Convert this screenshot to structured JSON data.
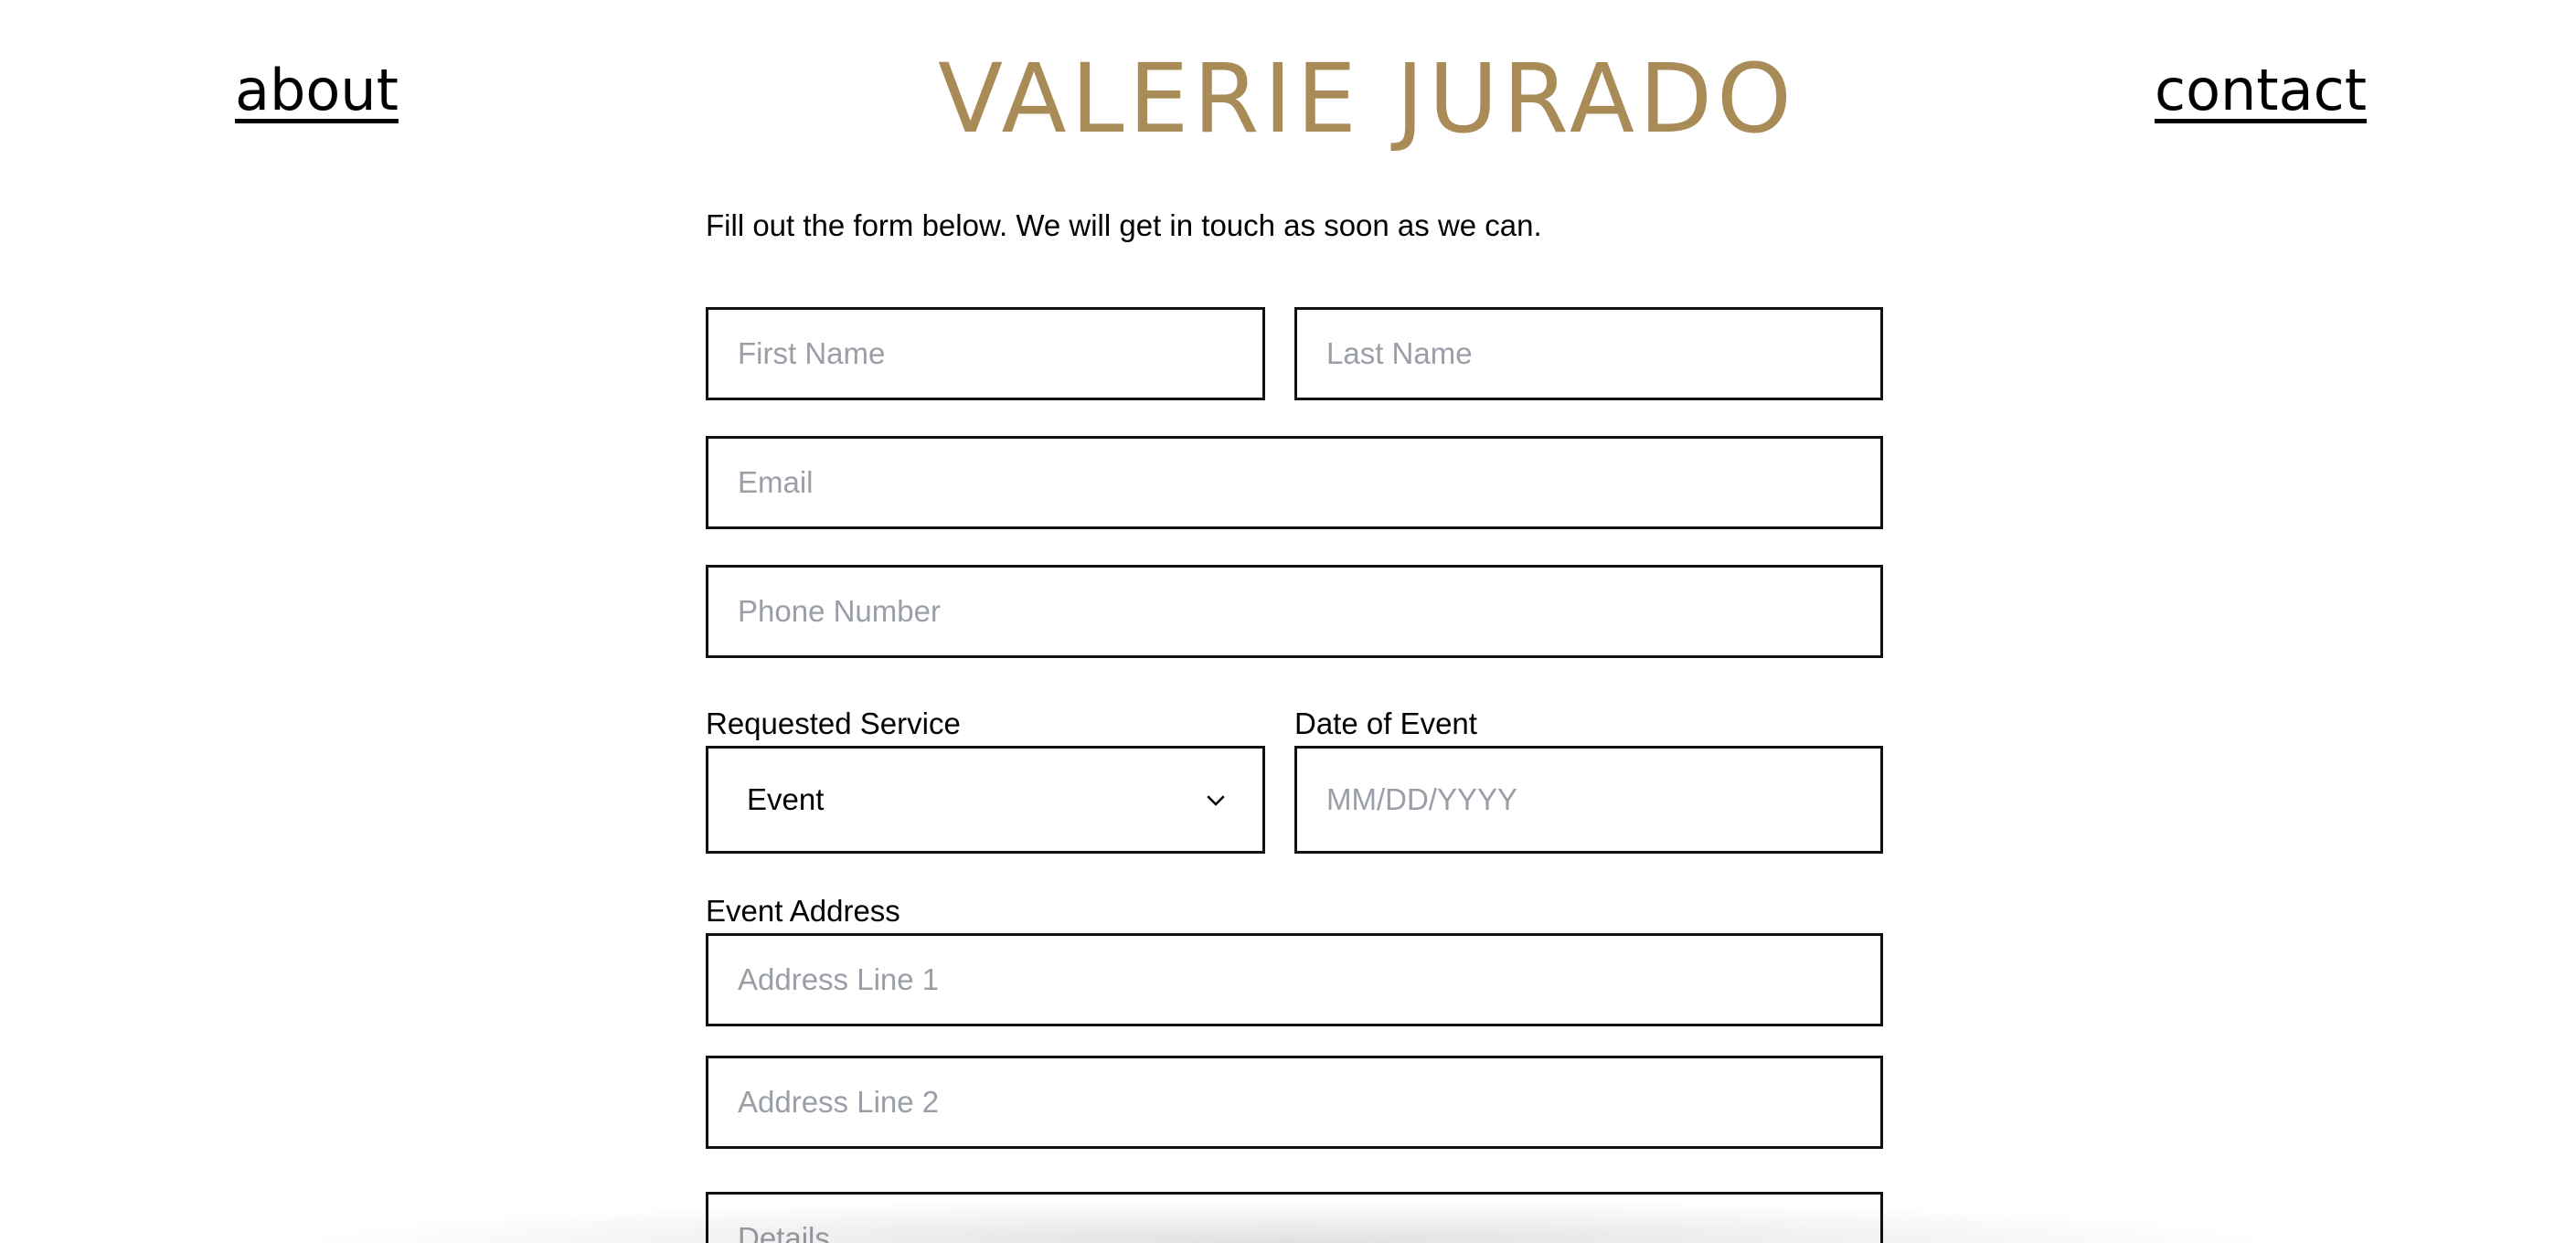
{
  "header": {
    "about_label": "about",
    "logo_text": "VALERIE JURADO",
    "contact_label": "contact",
    "logo_color": "#a88b56"
  },
  "form": {
    "intro": "Fill out the form below. We will get in touch as soon as we can.",
    "first_name_placeholder": "First Name",
    "last_name_placeholder": "Last Name",
    "email_placeholder": "Email",
    "phone_placeholder": "Phone Number",
    "service_label": "Requested Service",
    "service_value": "Event",
    "date_label": "Date of Event",
    "date_placeholder": "MM/DD/YYYY",
    "address_label": "Event Address",
    "address1_placeholder": "Address Line 1",
    "address2_placeholder": "Address Line 2",
    "details_placeholder": "Details"
  },
  "icons": {
    "service_dropdown": "chevron-down-icon"
  }
}
